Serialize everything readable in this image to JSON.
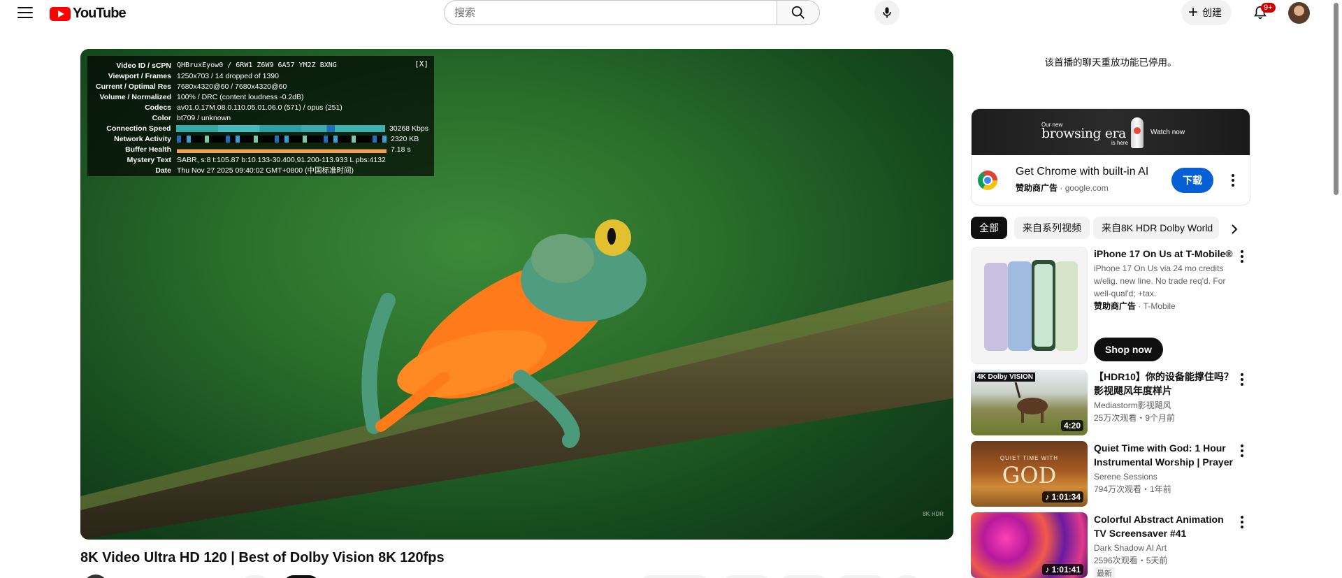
{
  "header": {
    "logo_text": "YouTube",
    "search_placeholder": "搜索",
    "create_label": "创建",
    "notif_badge": "9+"
  },
  "player": {
    "watermark": "8K HDR",
    "stats": {
      "close": "[X]",
      "rows": [
        {
          "label": "Video ID / sCPN",
          "value": "QHBruxEyow0 / 6RW1 Z6W9 6A57 YM2Z BXNG"
        },
        {
          "label": "Viewport / Frames",
          "value": "1250x703 / 14 dropped of 1390"
        },
        {
          "label": "Current / Optimal Res",
          "value": "7680x4320@60 / 7680x4320@60"
        },
        {
          "label": "Volume / Normalized",
          "value": "100% / DRC (content loudness -0.2dB)"
        },
        {
          "label": "Codecs",
          "value": "av01.0.17M.08.0.110.05.01.06.0 (571) / opus (251)"
        },
        {
          "label": "Color",
          "value": "bt709 / unknown"
        },
        {
          "label": "Connection Speed",
          "value": "30268 Kbps"
        },
        {
          "label": "Network Activity",
          "value": "2320 KB"
        },
        {
          "label": "Buffer Health",
          "value": "7.18 s"
        },
        {
          "label": "Mystery Text",
          "value": "SABR, s:8 t:105.87 b:10.133-30.400,91.200-113.933 L pbs:4132"
        },
        {
          "label": "Date",
          "value": "Thu Nov 27 2025 09:40:02 GMT+0800 (中国标准时间)"
        }
      ]
    }
  },
  "video": {
    "title": "8K Video Ultra HD 120 | Best of Dolby Vision 8K 120fps"
  },
  "sidebar": {
    "chat_note": "该首播的聊天重放功能已停用。",
    "ad": {
      "banner_small": "Our new",
      "banner_big": "browsing era",
      "banner_here": "is here",
      "banner_watch": "Watch now",
      "title": "Get Chrome with built-in AI",
      "sponsor": "赞助商广告",
      "domain": "google.com",
      "button": "下载"
    },
    "chips": [
      "全部",
      "来自系列视频",
      "来自8K HDR Dolby World"
    ],
    "recs": [
      {
        "title": "iPhone 17 On Us at T-Mobile®",
        "desc": "iPhone 17 On Us via 24 mo credits w/elig. new line. No trade req'd. For well-qual'd; +tax.",
        "sponsor": "赞助商广告",
        "advertiser": "T-Mobile",
        "button": "Shop now"
      },
      {
        "title": "【HDR10】你的设备能撑住吗？影视飓风年度样片",
        "channel": "Mediastorm影视飓风",
        "stats": "25万次观看・9个月前",
        "duration": "4:20",
        "thumb_badge": "4K Dolby VISION"
      },
      {
        "title": "Quiet Time with God: 1 Hour Instrumental Worship | Prayer ...",
        "channel": "Serene Sessions",
        "stats": "794万次观看・1年前",
        "duration": "1:01:34",
        "thumb_small": "QUIET TIME WITH",
        "thumb_big": "GOD"
      },
      {
        "title": "Colorful Abstract Animation TV Screensaver #41",
        "channel": "Dark Shadow AI Art",
        "stats": "2596次观看・5天前",
        "duration": "1:01:41",
        "badge": "最新"
      }
    ]
  }
}
